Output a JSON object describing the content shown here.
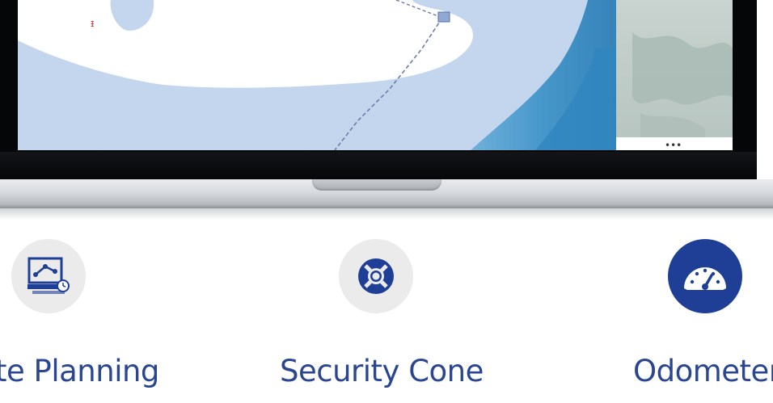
{
  "features": [
    {
      "label": "te Planning",
      "icon": "route-planning-icon",
      "icon_bg": "#ebebeb"
    },
    {
      "label": "Security Cone",
      "icon": "lifebuoy-icon",
      "icon_bg": "#ebebeb"
    },
    {
      "label": "Odometer",
      "icon": "speedometer-icon",
      "icon_bg": "#1f3f97"
    }
  ],
  "colors": {
    "accent": "#1f3f97",
    "label_text": "#2b4690",
    "map_water": "#c3d6ee",
    "map_deep_water": "#3f93c8"
  }
}
